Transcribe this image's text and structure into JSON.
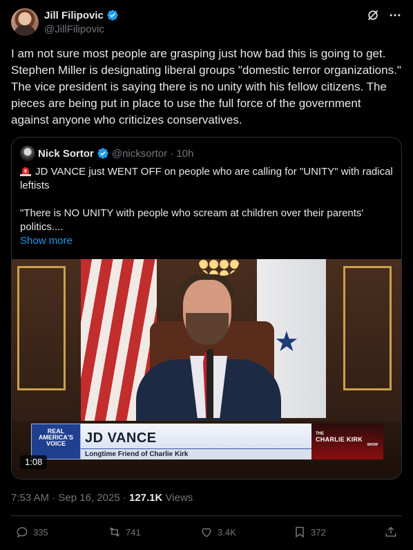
{
  "author": {
    "display_name": "Jill Filipovic",
    "handle": "@JillFilipovic",
    "verified": true
  },
  "header_icons": [
    "grok-icon",
    "more-icon"
  ],
  "post_text": "I am not sure most people are grasping just how bad this is going to get. Stephen Miller is designating liberal groups \"domestic terror organizations.\" The vice president is saying there is no unity with his fellow citizens. The pieces are being put in place to use the full force of the government against anyone who criticizes conservatives.",
  "quoted": {
    "display_name": "Nick Sortor",
    "handle": "@nicksortor",
    "time": "· 10h",
    "line1": "JD VANCE just WENT OFF on people who are calling for \"UNITY\" with radical leftists",
    "line2": "\"There is NO UNITY with people who scream at children over their parents' politics....",
    "show_more": "Show more",
    "video": {
      "duration": "1:08",
      "lower_third": {
        "network_line1": "REAL",
        "network_line2": "AMERICA'S",
        "network_line3": "VOICE",
        "name": "JD VANCE",
        "subtitle": "Longtime Friend of Charlie Kirk",
        "show_small": "THE",
        "show_big": "CHARLIE KIRK",
        "show_tag": "SHOW"
      }
    }
  },
  "meta": {
    "time": "7:53 AM",
    "date": "Sep 16, 2025",
    "views_count": "127.1K",
    "views_label": "Views"
  },
  "actions": {
    "replies": "335",
    "reposts": "741",
    "likes": "3.4K",
    "bookmarks": "372"
  },
  "colors": {
    "background": "#000000",
    "text": "#e7e9ea",
    "secondary": "#71767b",
    "accent": "#1d9bf0",
    "border": "#2f3336"
  }
}
